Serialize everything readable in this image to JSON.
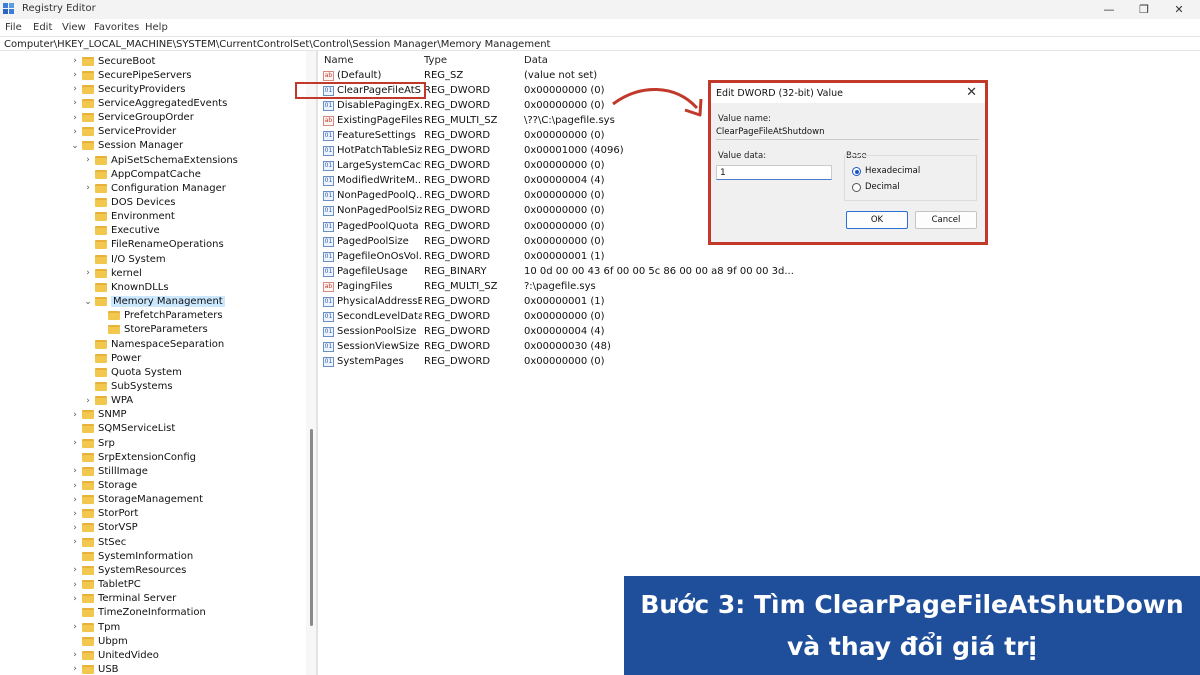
{
  "window": {
    "title": "Registry Editor"
  },
  "menu": [
    "File",
    "Edit",
    "View",
    "Favorites",
    "Help"
  ],
  "address": "Computer\\HKEY_LOCAL_MACHINE\\SYSTEM\\CurrentControlSet\\Control\\Session Manager\\Memory Management",
  "tree": [
    {
      "label": "SecureBoot",
      "level": 0,
      "chev": "›"
    },
    {
      "label": "SecurePipeServers",
      "level": 0,
      "chev": "›"
    },
    {
      "label": "SecurityProviders",
      "level": 0,
      "chev": "›"
    },
    {
      "label": "ServiceAggregatedEvents",
      "level": 0,
      "chev": "›"
    },
    {
      "label": "ServiceGroupOrder",
      "level": 0,
      "chev": "›"
    },
    {
      "label": "ServiceProvider",
      "level": 0,
      "chev": "›"
    },
    {
      "label": "Session Manager",
      "level": 0,
      "chev": "⌄"
    },
    {
      "label": "ApiSetSchemaExtensions",
      "level": 1,
      "chev": "›"
    },
    {
      "label": "AppCompatCache",
      "level": 1,
      "chev": ""
    },
    {
      "label": "Configuration Manager",
      "level": 1,
      "chev": "›"
    },
    {
      "label": "DOS Devices",
      "level": 1,
      "chev": ""
    },
    {
      "label": "Environment",
      "level": 1,
      "chev": ""
    },
    {
      "label": "Executive",
      "level": 1,
      "chev": ""
    },
    {
      "label": "FileRenameOperations",
      "level": 1,
      "chev": ""
    },
    {
      "label": "I/O System",
      "level": 1,
      "chev": ""
    },
    {
      "label": "kernel",
      "level": 1,
      "chev": "›"
    },
    {
      "label": "KnownDLLs",
      "level": 1,
      "chev": ""
    },
    {
      "label": "Memory Management",
      "level": 1,
      "chev": "⌄",
      "selected": true
    },
    {
      "label": "PrefetchParameters",
      "level": 2,
      "chev": ""
    },
    {
      "label": "StoreParameters",
      "level": 2,
      "chev": ""
    },
    {
      "label": "NamespaceSeparation",
      "level": 1,
      "chev": ""
    },
    {
      "label": "Power",
      "level": 1,
      "chev": ""
    },
    {
      "label": "Quota System",
      "level": 1,
      "chev": ""
    },
    {
      "label": "SubSystems",
      "level": 1,
      "chev": ""
    },
    {
      "label": "WPA",
      "level": 1,
      "chev": "›"
    },
    {
      "label": "SNMP",
      "level": 0,
      "chev": "›"
    },
    {
      "label": "SQMServiceList",
      "level": 0,
      "chev": ""
    },
    {
      "label": "Srp",
      "level": 0,
      "chev": "›"
    },
    {
      "label": "SrpExtensionConfig",
      "level": 0,
      "chev": ""
    },
    {
      "label": "StillImage",
      "level": 0,
      "chev": "›"
    },
    {
      "label": "Storage",
      "level": 0,
      "chev": "›"
    },
    {
      "label": "StorageManagement",
      "level": 0,
      "chev": "›"
    },
    {
      "label": "StorPort",
      "level": 0,
      "chev": "›"
    },
    {
      "label": "StorVSP",
      "level": 0,
      "chev": "›"
    },
    {
      "label": "StSec",
      "level": 0,
      "chev": "›"
    },
    {
      "label": "SystemInformation",
      "level": 0,
      "chev": ""
    },
    {
      "label": "SystemResources",
      "level": 0,
      "chev": "›"
    },
    {
      "label": "TabletPC",
      "level": 0,
      "chev": "›"
    },
    {
      "label": "Terminal Server",
      "level": 0,
      "chev": "›"
    },
    {
      "label": "TimeZoneInformation",
      "level": 0,
      "chev": ""
    },
    {
      "label": "Tpm",
      "level": 0,
      "chev": "›"
    },
    {
      "label": "Ubpm",
      "level": 0,
      "chev": ""
    },
    {
      "label": "UnitedVideo",
      "level": 0,
      "chev": "›"
    },
    {
      "label": "USB",
      "level": 0,
      "chev": "›"
    }
  ],
  "columns": {
    "name": "Name",
    "type": "Type",
    "data": "Data"
  },
  "values": [
    {
      "name": "(Default)",
      "type": "REG_SZ",
      "data": "(value not set)",
      "icon": "sz"
    },
    {
      "name": "ClearPageFileAtS...",
      "type": "REG_DWORD",
      "data": "0x00000000 (0)",
      "icon": "bin"
    },
    {
      "name": "DisablePagingEx...",
      "type": "REG_DWORD",
      "data": "0x00000000 (0)",
      "icon": "bin"
    },
    {
      "name": "ExistingPageFiles",
      "type": "REG_MULTI_SZ",
      "data": "\\??\\C:\\pagefile.sys",
      "icon": "sz"
    },
    {
      "name": "FeatureSettings",
      "type": "REG_DWORD",
      "data": "0x00000000 (0)",
      "icon": "bin"
    },
    {
      "name": "HotPatchTableSize",
      "type": "REG_DWORD",
      "data": "0x00001000 (4096)",
      "icon": "bin"
    },
    {
      "name": "LargeSystemCache",
      "type": "REG_DWORD",
      "data": "0x00000000 (0)",
      "icon": "bin"
    },
    {
      "name": "ModifiedWriteM...",
      "type": "REG_DWORD",
      "data": "0x00000004 (4)",
      "icon": "bin"
    },
    {
      "name": "NonPagedPoolQ...",
      "type": "REG_DWORD",
      "data": "0x00000000 (0)",
      "icon": "bin"
    },
    {
      "name": "NonPagedPoolSize",
      "type": "REG_DWORD",
      "data": "0x00000000 (0)",
      "icon": "bin"
    },
    {
      "name": "PagedPoolQuota",
      "type": "REG_DWORD",
      "data": "0x00000000 (0)",
      "icon": "bin"
    },
    {
      "name": "PagedPoolSize",
      "type": "REG_DWORD",
      "data": "0x00000000 (0)",
      "icon": "bin"
    },
    {
      "name": "PagefileOnOsVol...",
      "type": "REG_DWORD",
      "data": "0x00000001 (1)",
      "icon": "bin"
    },
    {
      "name": "PagefileUsage",
      "type": "REG_BINARY",
      "data": "10 0d 00 00 43 6f 00 00 5c 86 00 00 a8 9f 00 00 3d...",
      "icon": "bin"
    },
    {
      "name": "PagingFiles",
      "type": "REG_MULTI_SZ",
      "data": "?:\\pagefile.sys",
      "icon": "sz"
    },
    {
      "name": "PhysicalAddressE...",
      "type": "REG_DWORD",
      "data": "0x00000001 (1)",
      "icon": "bin"
    },
    {
      "name": "SecondLevelData...",
      "type": "REG_DWORD",
      "data": "0x00000000 (0)",
      "icon": "bin"
    },
    {
      "name": "SessionPoolSize",
      "type": "REG_DWORD",
      "data": "0x00000004 (4)",
      "icon": "bin"
    },
    {
      "name": "SessionViewSize",
      "type": "REG_DWORD",
      "data": "0x00000030 (48)",
      "icon": "bin"
    },
    {
      "name": "SystemPages",
      "type": "REG_DWORD",
      "data": "0x00000000 (0)",
      "icon": "bin"
    }
  ],
  "dialog": {
    "title": "Edit DWORD (32-bit) Value",
    "value_name_label": "Value name:",
    "value_name": "ClearPageFileAtShutdown",
    "value_data_label": "Value data:",
    "value_data": "1",
    "base_label": "Base",
    "hex_label": "Hexadecimal",
    "dec_label": "Decimal",
    "ok": "OK",
    "cancel": "Cancel"
  },
  "banner": {
    "line1": "Bước 3: Tìm ClearPageFileAtShutDown",
    "line2": "và thay đổi giá trị"
  },
  "colors": {
    "highlight": "#c0392b",
    "banner_bg": "#1f4f9a"
  }
}
